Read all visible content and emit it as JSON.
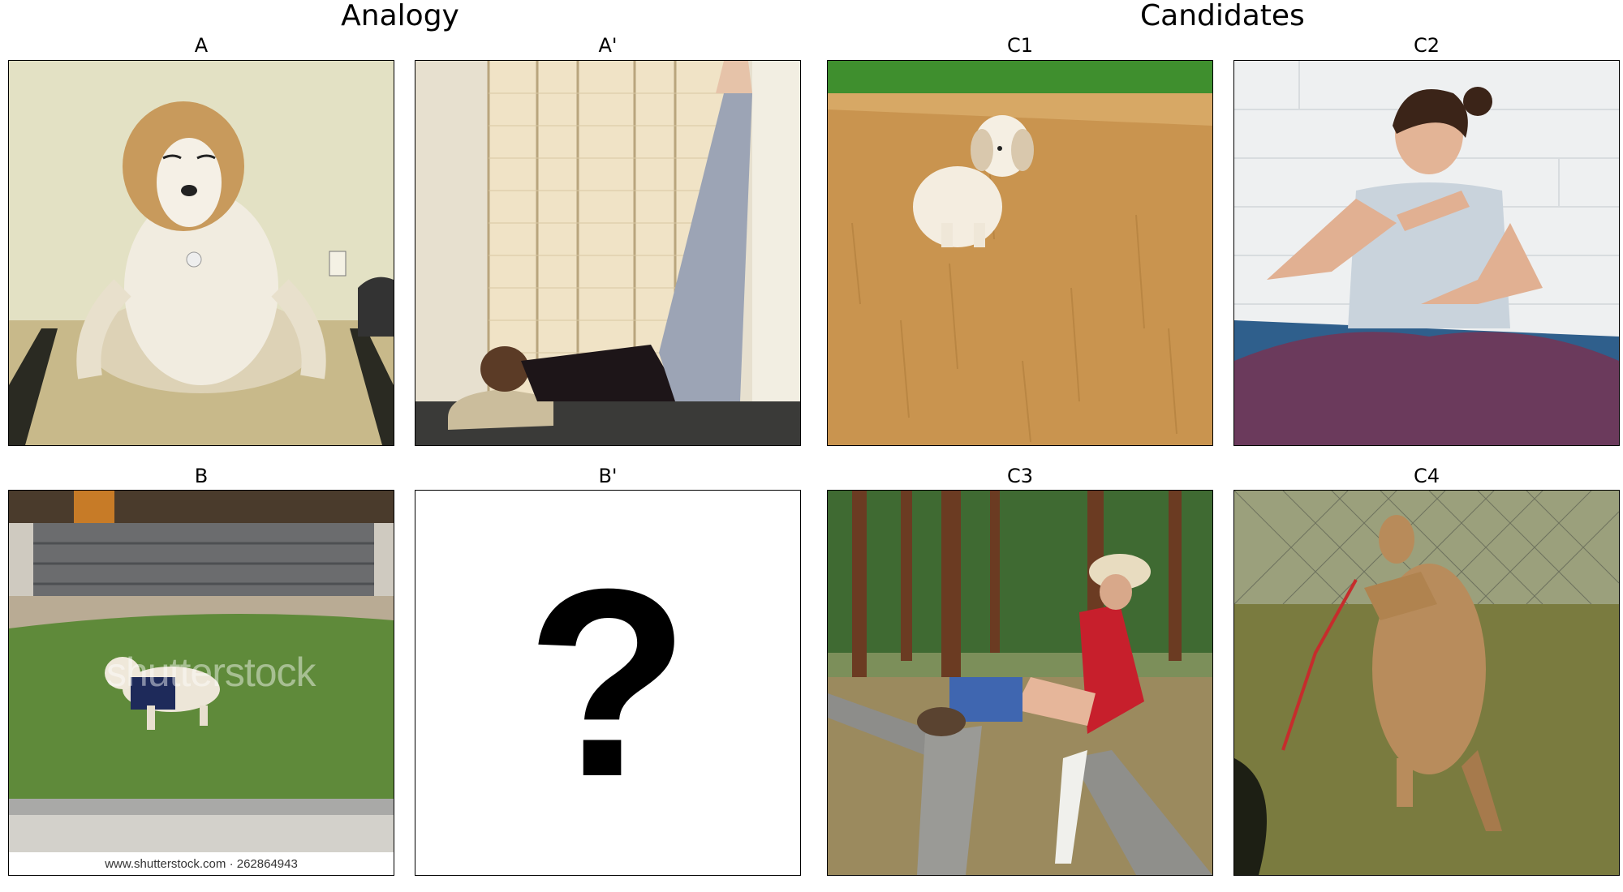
{
  "headers": {
    "analogy": "Analogy",
    "candidates": "Candidates"
  },
  "panels": {
    "a": "A",
    "a_prime": "A'",
    "b": "B",
    "b_prime": "B'",
    "c1": "C1",
    "c2": "C2",
    "c3": "C3",
    "c4": "C4"
  },
  "placeholder_symbol": "?",
  "watermark": {
    "overlay": "shutterstock",
    "footer": "www.shutterstock.com · 262864943"
  }
}
